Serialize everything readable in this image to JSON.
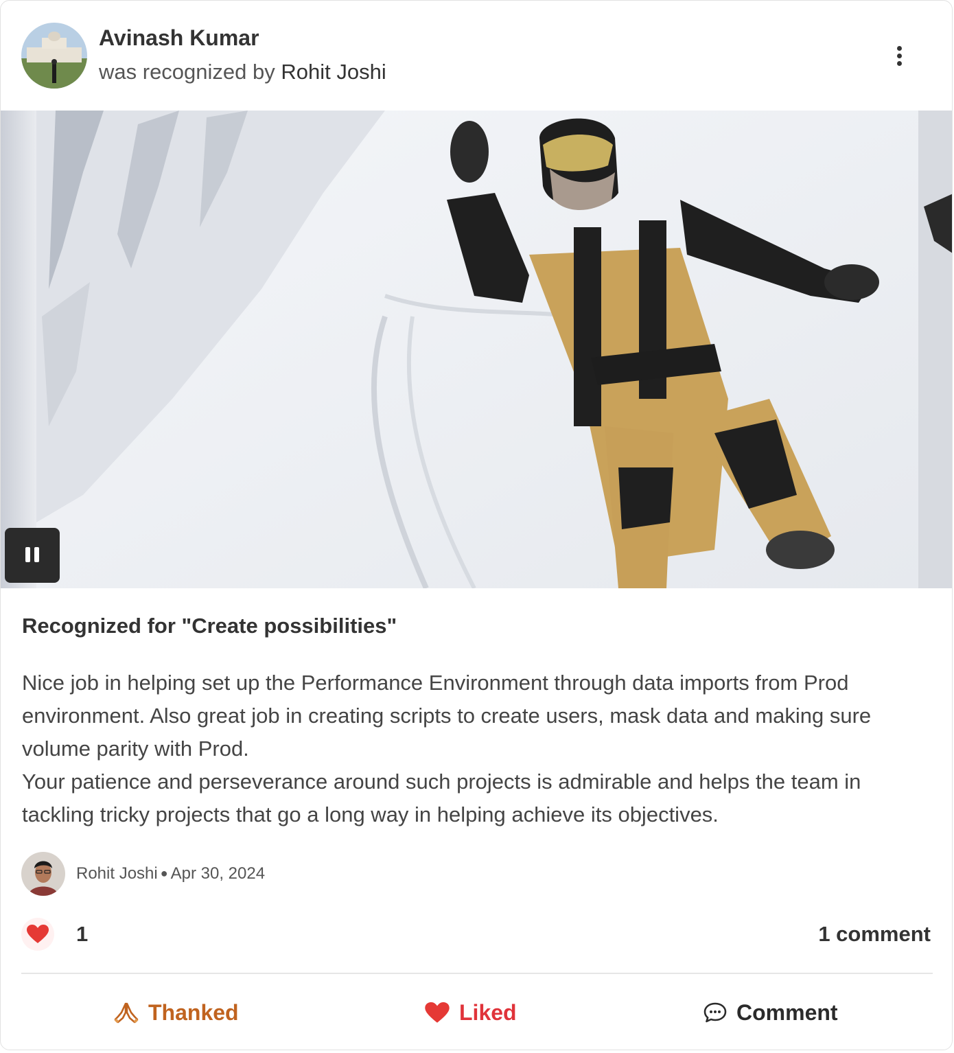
{
  "post": {
    "recipient_name": "Avinash Kumar",
    "recognized_prefix": "was recognized by",
    "giver_name": "Rohit Joshi",
    "value_title": "Recognized for \"Create possibilities\"",
    "message_paragraphs": [
      "Nice job in helping set up the Performance Environment through data imports from Prod environment. Also great job in creating scripts to create users, mask data and making sure volume parity with Prod.",
      "Your patience and perseverance around such projects is admirable and helps the team in tackling tricky projects that go a long way in helping achieve its objectives."
    ],
    "date": "Apr 30, 2024",
    "like_count": "1",
    "comment_count_label": "1 comment"
  },
  "actions": {
    "thanked_label": "Thanked",
    "liked_label": "Liked",
    "comment_label": "Comment"
  },
  "icons": {
    "more": "kebab-vertical-icon",
    "pause": "pause-icon",
    "heart": "heart-icon",
    "thanks": "praying-hands-icon",
    "comment": "speech-bubble-icon"
  },
  "colors": {
    "thanked": "#c0631f",
    "liked": "#e0333a",
    "heart": "#e53935",
    "text": "#333333"
  }
}
